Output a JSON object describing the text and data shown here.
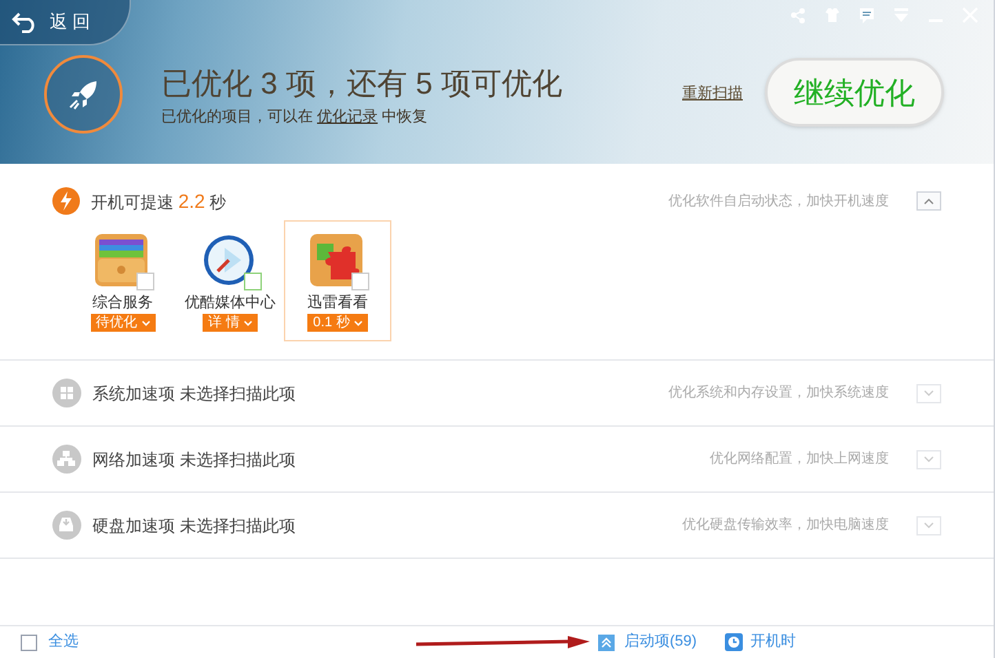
{
  "header": {
    "back_label": "返 回",
    "title": "已优化 3 项，还有 5 项可优化",
    "subtitle_before": "已优化的项目，可以在",
    "subtitle_link": "优化记录",
    "subtitle_after": "中恢复",
    "rescan": "重新扫描",
    "primary_button": "继续优化"
  },
  "sections": [
    {
      "kind": "startup",
      "title": "开机可提速",
      "value": "2.2",
      "unit": "秒",
      "hint": "优化软件自启动状态，加快开机速度",
      "expanded": true,
      "items": [
        {
          "name": "综合服务",
          "action": "待优化",
          "checked": false,
          "selected": false
        },
        {
          "name": "优酷媒体中心",
          "action": "详 情",
          "checked": false,
          "selected": false
        },
        {
          "name": "迅雷看看",
          "action": "0.1 秒",
          "checked": false,
          "selected": true
        }
      ]
    },
    {
      "kind": "plain",
      "title": "系统加速项 未选择扫描此项",
      "hint": "优化系统和内存设置，加快系统速度",
      "expanded": false
    },
    {
      "kind": "plain",
      "title": "网络加速项 未选择扫描此项",
      "hint": "优化网络配置，加快上网速度",
      "expanded": false
    },
    {
      "kind": "plain",
      "title": "硬盘加速项 未选择扫描此项",
      "hint": "优化硬盘传输效率，加快电脑速度",
      "expanded": false
    }
  ],
  "footer": {
    "select_all": "全选",
    "select_all_checked": false,
    "startup_link": "启动项(59)",
    "boot_link": "开机时"
  }
}
